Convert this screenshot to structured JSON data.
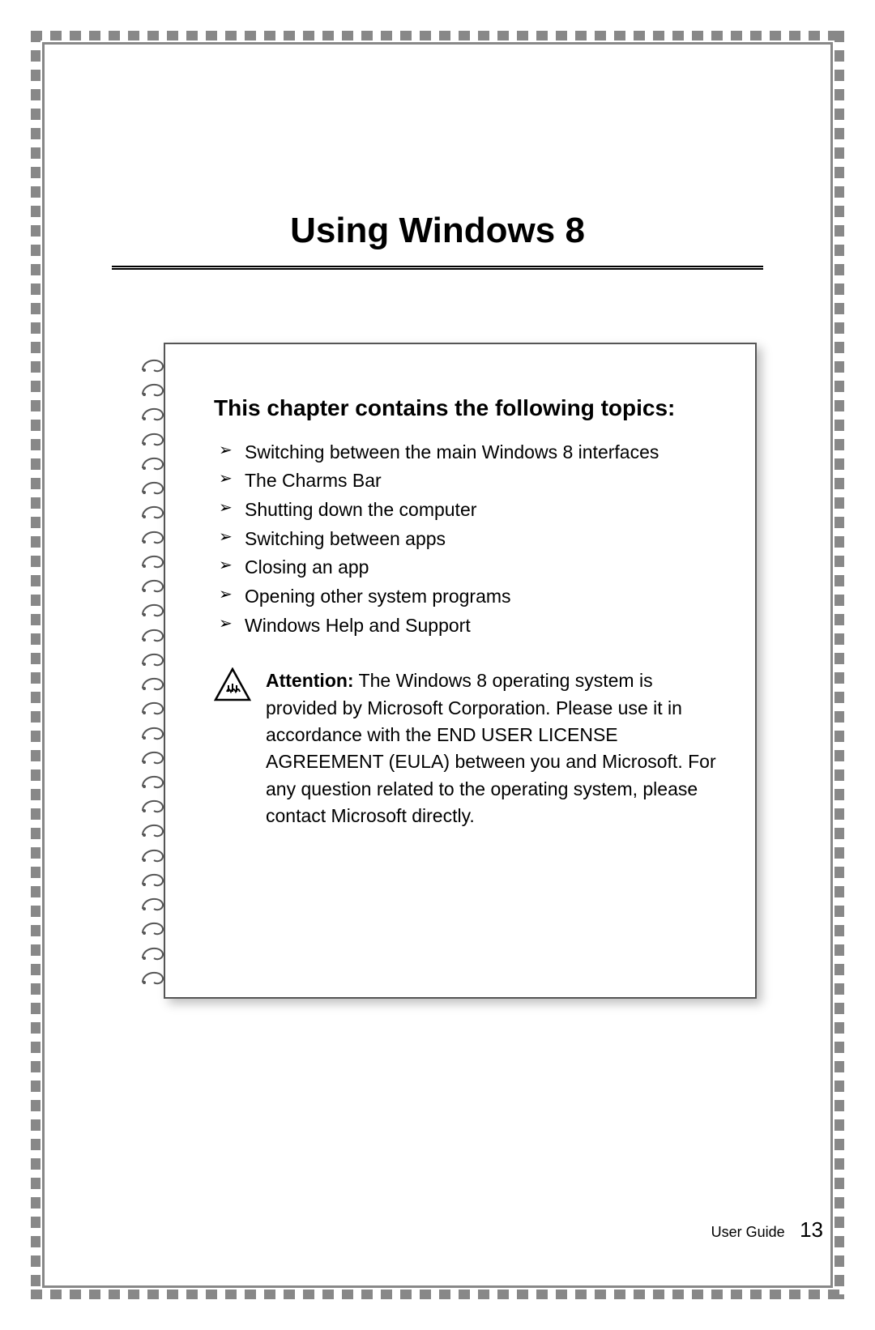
{
  "chapter_title": "Using Windows 8",
  "subheading": "This chapter contains the following topics:",
  "topics": [
    "Switching between the main Windows 8 interfaces",
    "The Charms Bar",
    "Shutting down the computer",
    "Switching between apps",
    "Closing an app",
    "Opening other system programs",
    "Windows Help and Support"
  ],
  "attention": {
    "label": "Attention:",
    "body": " The Windows 8 operating system is provided by Microsoft Corporation. Please use it in accordance with the END USER LICENSE AGREEMENT (EULA) between you and Microsoft. For any question related to the operating system, please contact Microsoft directly."
  },
  "footer": {
    "label": "User Guide",
    "page": "13"
  },
  "spiral_count": 26
}
